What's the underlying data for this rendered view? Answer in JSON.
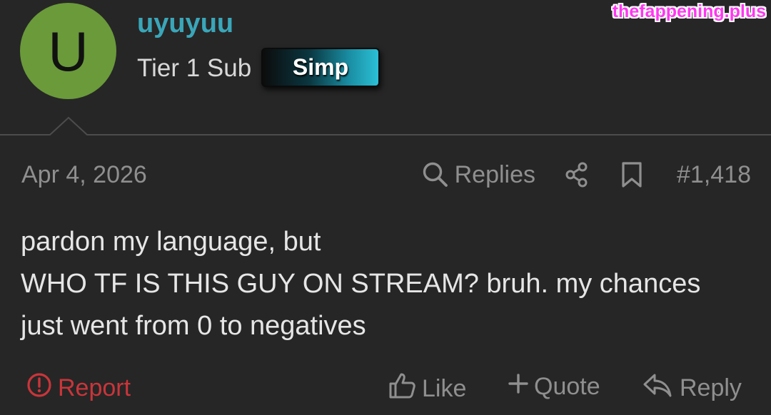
{
  "user": {
    "avatar_letter": "U",
    "avatar_color": "#6a9a3a",
    "name": "uyuyuu",
    "title": "Tier 1 Sub",
    "badge": "Simp"
  },
  "watermark": "thefappening.plus",
  "post": {
    "date": "Apr 4, 2026",
    "replies_label": "Replies",
    "number": "#1,418",
    "message_lines": [
      "pardon my language, but",
      "WHO TF IS THIS GUY ON STREAM? bruh. my chances",
      "just went from 0 to negatives"
    ]
  },
  "actions": {
    "report": "Report",
    "like": "Like",
    "quote": "Quote",
    "reply": "Reply"
  },
  "icons": {
    "search": "search-icon",
    "share": "share-icon",
    "bookmark": "bookmark-icon",
    "report": "alert-circle-icon",
    "like": "thumbs-up-icon",
    "quote": "plus-icon",
    "reply": "reply-icon"
  },
  "colors": {
    "background": "#262626",
    "username": "#3aa6b9",
    "report": "#c9353a",
    "muted": "#8f8f8f",
    "watermark": "#ff37f0"
  }
}
